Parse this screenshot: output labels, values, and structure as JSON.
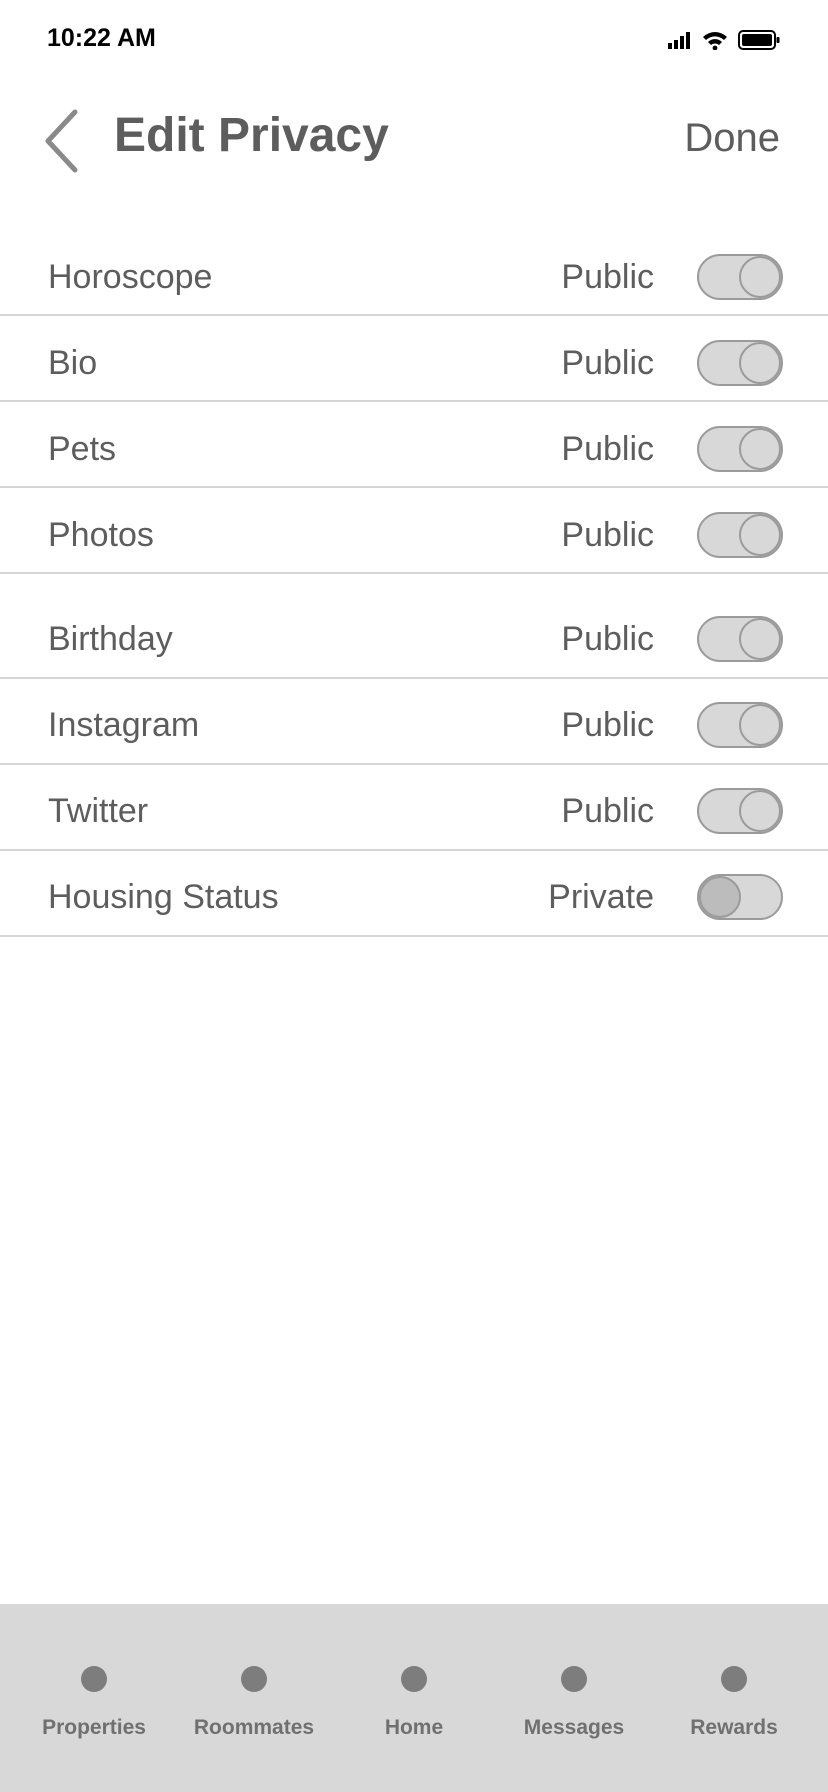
{
  "status_bar": {
    "time": "10:22 AM",
    "icons": [
      "signal-icon",
      "wifi-icon",
      "battery-icon"
    ]
  },
  "header": {
    "back_icon": "chevron-left-icon",
    "title": "Edit Privacy",
    "done_label": "Done"
  },
  "rows": [
    {
      "label": "Horoscope",
      "status": "Public",
      "on": true
    },
    {
      "label": "Bio",
      "status": "Public",
      "on": true
    },
    {
      "label": "Pets",
      "status": "Public",
      "on": true
    },
    {
      "label": "Photos",
      "status": "Public",
      "on": true
    },
    {
      "label": "Birthday",
      "status": "Public",
      "on": true
    },
    {
      "label": "Instagram",
      "status": "Public",
      "on": true
    },
    {
      "label": "Twitter",
      "status": "Public",
      "on": true
    },
    {
      "label": "Housing Status",
      "status": "Private",
      "on": false
    }
  ],
  "tab_bar": {
    "tabs": [
      {
        "label": "Properties"
      },
      {
        "label": "Roommates"
      },
      {
        "label": "Home"
      },
      {
        "label": "Messages"
      },
      {
        "label": "Rewards"
      }
    ]
  },
  "colors": {
    "text": "#5d5d5d",
    "toggle_fill": "#d8d8d8",
    "toggle_border": "#9b9b9b",
    "tab_bar_bg": "#d8d8d8",
    "divider": "#d6d6d6"
  }
}
